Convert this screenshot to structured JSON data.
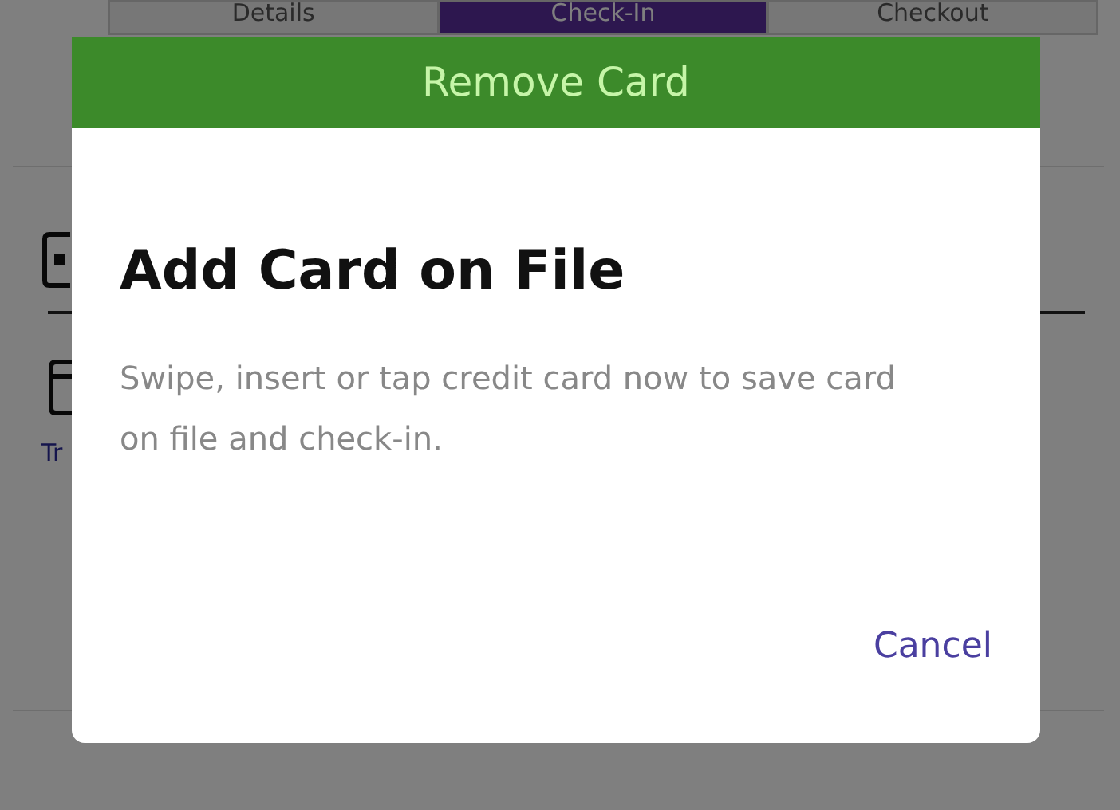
{
  "tabs": [
    {
      "label": "Details",
      "selected": false
    },
    {
      "label": "Check-In",
      "selected": true
    },
    {
      "label": "Checkout",
      "selected": false
    }
  ],
  "background_link": "Tr",
  "modal": {
    "banner": "Remove Card",
    "title": "Add Card on File",
    "message": "Swipe, insert or tap credit card now to save card on file and check-in.",
    "buttons": [
      "Cancel"
    ]
  }
}
